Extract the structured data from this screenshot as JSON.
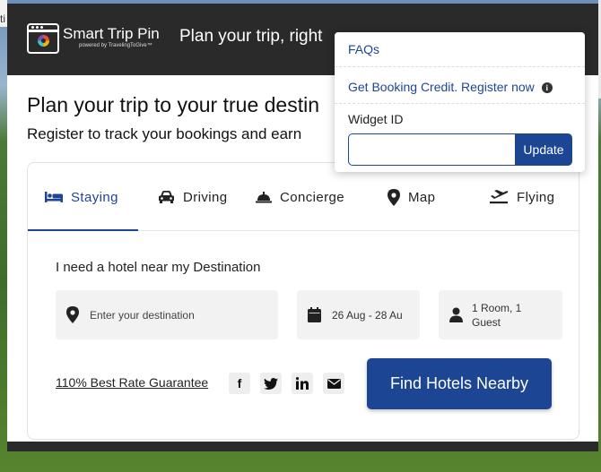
{
  "background_tab": {
    "text": "ti"
  },
  "header": {
    "brand_name": "Smart Trip Pin",
    "brand_sub": "powered by TravelingToGive™",
    "title": "Plan your trip, right"
  },
  "main": {
    "title": "Plan your trip to your true destin",
    "subtitle": "Register to track your bookings and earn"
  },
  "tabs": [
    {
      "label": "Staying",
      "icon": "bed-icon",
      "active": true
    },
    {
      "label": "Driving",
      "icon": "car-icon",
      "active": false
    },
    {
      "label": "Concierge",
      "icon": "bell-icon",
      "active": false
    },
    {
      "label": "Map",
      "icon": "map-pin-icon",
      "active": false
    },
    {
      "label": "Flying",
      "icon": "plane-icon",
      "active": false
    }
  ],
  "search": {
    "heading": "I need a hotel near my Destination",
    "destination_placeholder": "Enter your destination",
    "dates": "26 Aug - 28 Au",
    "guests": "1 Room, 1 Guest",
    "rate_guarantee": "110% Best Rate Guarantee",
    "find_button": "Find Hotels Nearby"
  },
  "social": [
    {
      "icon": "facebook-icon"
    },
    {
      "icon": "twitter-icon"
    },
    {
      "icon": "linkedin-icon"
    },
    {
      "icon": "email-icon"
    }
  ],
  "dropdown": {
    "faqs": "FAQs",
    "booking_credit": "Get Booking Credit. Register now",
    "widget_label": "Widget ID",
    "widget_value": "",
    "update_button": "Update"
  },
  "colors": {
    "brand_blue": "#1c4593",
    "header_dark": "#2a2a2a",
    "field_bg": "#f2f2f2"
  }
}
